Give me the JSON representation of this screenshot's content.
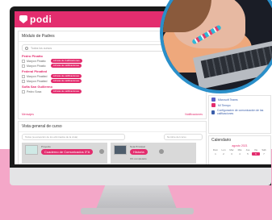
{
  "app": {
    "brand": "podi"
  },
  "modulo": {
    "title": "Módulo de Padres",
    "search_placeholder": "Todos los cursos",
    "schools": [
      {
        "name": "Pedro Pinatto",
        "students": [
          {
            "name": "Maryon Pinatto",
            "buttons": [
              "Libreta de Calificaciones"
            ]
          },
          {
            "name": "Maryon Pinatto",
            "buttons": [
              "Libreta de calificaciones"
            ]
          }
        ]
      },
      {
        "name": "Federal Pinatted",
        "students": [
          {
            "name": "Maryon Pinatted",
            "buttons": [
              "Libreta de calificaciones"
            ]
          },
          {
            "name": "Maryon Pinatted",
            "buttons": [
              "Libreta de calificaciones"
            ]
          }
        ]
      },
      {
        "name": "Sofia San Guillermo",
        "students": [
          {
            "name": "Pedro Sosa",
            "buttons": [
              "Libreta de calificaciones"
            ]
          }
        ]
      }
    ],
    "footer_left": "Mensajes",
    "footer_right": "Notificaciones"
  },
  "right_panel": {
    "items": [
      {
        "label": "Microsoft Teams",
        "icon": "teams-icon",
        "color": "#5b5fc7"
      },
      {
        "label": "Mi Tiempo",
        "icon": "clock-icon",
        "color": "#e32d6e"
      },
      {
        "label": "Configuración de comunicación de las calificaciones",
        "icon": "settings-icon",
        "color": "#3a5eaa"
      }
    ]
  },
  "calendar": {
    "title": "Calendario",
    "month": "agosto 2021",
    "weekdays": [
      "Dom",
      "Lun",
      "Mar",
      "Mié",
      "Jue",
      "Vie",
      "Sáb"
    ],
    "days": [
      "1",
      "2",
      "3",
      "4",
      "5",
      "6",
      "7"
    ],
    "today": "6"
  },
  "vista": {
    "title": "Vista general de curso",
    "filter_placeholder": "Todos (a excepción de los eliminados de la vista)",
    "sort_label": "Nombre del curso",
    "courses": [
      {
        "small_label": "Proyecto",
        "name": "Cuaderno de Comunicados 3°A",
        "meta": ""
      },
      {
        "small_label": "Nota Principal",
        "name": "Historia",
        "meta": "0% completado"
      }
    ]
  },
  "colors": {
    "brand": "#e32d6e",
    "background": "#f4a7c8"
  }
}
